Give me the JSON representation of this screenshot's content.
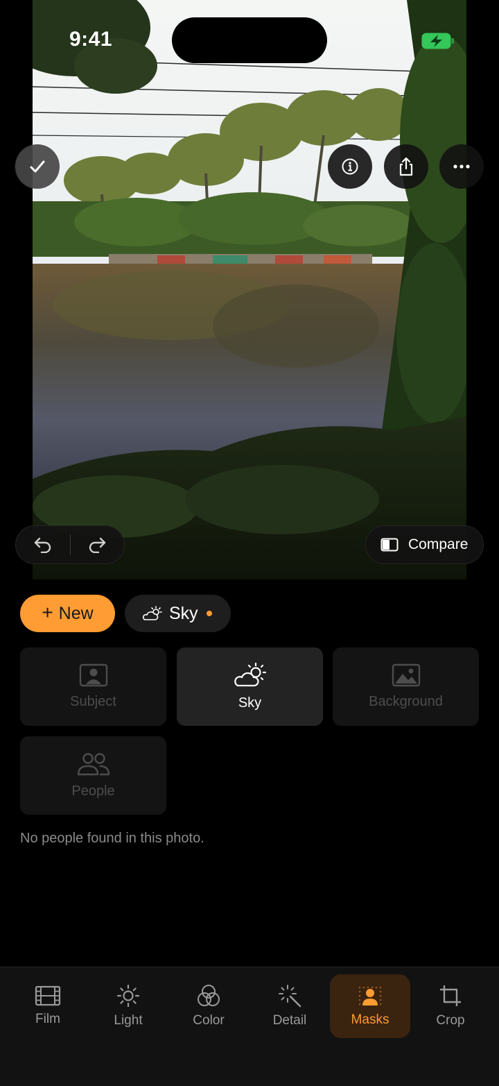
{
  "status_bar": {
    "time": "9:41"
  },
  "toolbar": {
    "done_icon": "checkmark-icon",
    "info_icon": "info-icon",
    "share_icon": "share-icon",
    "more_icon": "ellipsis-icon"
  },
  "history": {
    "undo_icon": "undo-icon",
    "redo_icon": "redo-icon"
  },
  "compare": {
    "label": "Compare",
    "icon": "split-view-icon"
  },
  "mask_chips": {
    "new_label": "New",
    "new_plus": "+",
    "sky_label": "Sky"
  },
  "mask_cards": [
    {
      "label": "Subject",
      "icon": "portrait-icon",
      "active": false
    },
    {
      "label": "Sky",
      "icon": "cloud-sun-icon",
      "active": true
    },
    {
      "label": "Background",
      "icon": "image-icon",
      "active": false
    },
    {
      "label": "People",
      "icon": "people-icon",
      "active": false
    }
  ],
  "message": "No people found in this photo.",
  "tabs": [
    {
      "label": "Film",
      "icon": "film-icon"
    },
    {
      "label": "Light",
      "icon": "sun-icon"
    },
    {
      "label": "Color",
      "icon": "color-circles-icon"
    },
    {
      "label": "Detail",
      "icon": "sparkle-wand-icon"
    },
    {
      "label": "Masks",
      "icon": "mask-person-icon",
      "active": true
    },
    {
      "label": "Crop",
      "icon": "crop-icon"
    }
  ],
  "colors": {
    "accent": "#ff9c33",
    "background": "#000000",
    "card": "#141414",
    "card_active": "#232323",
    "tab_active_bg": "#3a230f"
  }
}
